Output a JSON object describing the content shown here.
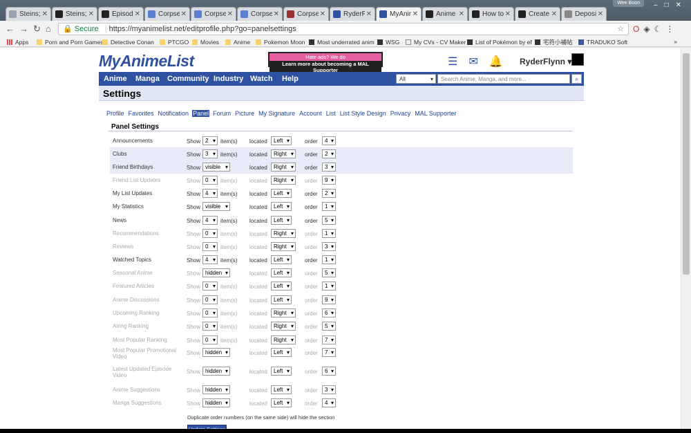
{
  "browser": {
    "tabs": [
      {
        "label": "Steins;G",
        "color": "#9aa3ab"
      },
      {
        "label": "Steins;G",
        "color": "#222"
      },
      {
        "label": "Episodes",
        "color": "#222"
      },
      {
        "label": "Corpse",
        "color": "#5b7fd0"
      },
      {
        "label": "Corpse",
        "color": "#5b7fd0"
      },
      {
        "label": "Corpse",
        "color": "#5b7fd0"
      },
      {
        "label": "Corpse",
        "color": "#a03030"
      },
      {
        "label": "RyderFl",
        "color": "#2e51a2"
      },
      {
        "label": "MyAnim",
        "color": "#2e51a2"
      },
      {
        "label": "Anime",
        "color": "#222"
      },
      {
        "label": "How to",
        "color": "#222"
      },
      {
        "label": "Create",
        "color": "#222"
      },
      {
        "label": "Deposi",
        "color": "#888"
      }
    ],
    "user_chip": "Wee Boon",
    "secure_label": "Secure",
    "url": "https://myanimelist.net/editprofile.php?go=panelsettings",
    "bookmarks": [
      {
        "label": "Apps",
        "kind": "apps"
      },
      {
        "label": "Porn and Porn Games",
        "kind": "folder"
      },
      {
        "label": "Detective Conan",
        "kind": "folder"
      },
      {
        "label": "PTCGO",
        "kind": "folder"
      },
      {
        "label": "Movies",
        "kind": "folder"
      },
      {
        "label": "Anime",
        "kind": "folder"
      },
      {
        "label": "Pokemon Moon",
        "kind": "folder"
      },
      {
        "label": "Most underrated anim",
        "kind": "site"
      },
      {
        "label": "WSG",
        "kind": "site"
      },
      {
        "label": "My CVs - CV Maker",
        "kind": "page"
      },
      {
        "label": "List of Pokémon by ef",
        "kind": "site"
      },
      {
        "label": "宅符小補帖",
        "kind": "site"
      },
      {
        "label": "TRADUKO Soft",
        "kind": "fb"
      }
    ]
  },
  "site": {
    "logo": "MyAnimeList",
    "ad_line1": "Hate ads?  We do",
    "ad_line2": "Learn more about becoming a MAL Supporter",
    "username": "RyderFlynn ▾",
    "nav": [
      "Anime",
      "Manga",
      "Community",
      "Industry",
      "Watch",
      "Help"
    ],
    "search_scope": "All",
    "search_placeholder": "Search Anime, Manga, and more...",
    "page_title": "Settings",
    "subtabs": [
      "Profile",
      "Favorites",
      "Notification",
      "Panel",
      "Forum",
      "Picture",
      "My Signature",
      "Account",
      "List",
      "List Style Design",
      "Privacy",
      "MAL Supporter"
    ],
    "active_subtab": "Panel",
    "section_title": "Panel Settings",
    "labels": {
      "show": "Show",
      "items": "item(s)",
      "located": "located",
      "order": "order"
    },
    "rows": [
      {
        "name": "Announcements",
        "show": "2",
        "located": "Left",
        "order": "4",
        "enabled": true,
        "hl": false
      },
      {
        "name": "Clubs",
        "show": "3",
        "located": "Right",
        "order": "2",
        "enabled": true,
        "hl": true
      },
      {
        "name": "Friend Birthdays",
        "show": "visible",
        "located": "Right",
        "order": "3",
        "enabled": true,
        "hl": true
      },
      {
        "name": "Friend List Updates",
        "show": "0",
        "located": "Right",
        "order": "9",
        "enabled": false,
        "hl": false
      },
      {
        "name": "My List Updates",
        "show": "4",
        "located": "Left",
        "order": "2",
        "enabled": true,
        "hl": false
      },
      {
        "name": "My Statistics",
        "show": "visible",
        "located": "Left",
        "order": "1",
        "enabled": true,
        "hl": false
      },
      {
        "name": "News",
        "show": "4",
        "located": "Left",
        "order": "5",
        "enabled": true,
        "hl": false
      },
      {
        "name": "Recommendations",
        "show": "0",
        "located": "Right",
        "order": "1",
        "enabled": false,
        "hl": false
      },
      {
        "name": "Reviews",
        "show": "0",
        "located": "Right",
        "order": "3",
        "enabled": false,
        "hl": false
      },
      {
        "name": "Watched Topics",
        "show": "4",
        "located": "Left",
        "order": "1",
        "enabled": true,
        "hl": false
      },
      {
        "name": "Seasonal Anime",
        "show": "hidden",
        "located": "Left",
        "order": "5",
        "enabled": false,
        "hl": false
      },
      {
        "name": "Featured Articles",
        "show": "0",
        "located": "Left",
        "order": "1",
        "enabled": false,
        "hl": false
      },
      {
        "name": "Anime Discussions",
        "show": "0",
        "located": "Left",
        "order": "9",
        "enabled": false,
        "hl": false
      },
      {
        "name": "Upcoming Ranking",
        "show": "0",
        "located": "Right",
        "order": "6",
        "enabled": false,
        "hl": false
      },
      {
        "name": "Airing Ranking",
        "show": "0",
        "located": "Right",
        "order": "5",
        "enabled": false,
        "hl": false
      },
      {
        "name": "Most Popular Ranking",
        "show": "0",
        "located": "Right",
        "order": "7",
        "enabled": false,
        "hl": false
      },
      {
        "name": "Most Popular Promotional Video",
        "show": "hidden",
        "located": "Left",
        "order": "7",
        "enabled": false,
        "hl": false
      },
      {
        "name": "Latest Updated Episode Video",
        "show": "hidden",
        "located": "Left",
        "order": "6",
        "enabled": false,
        "hl": false
      },
      {
        "name": "Anime Suggestions",
        "show": "hidden",
        "located": "Left",
        "order": "3",
        "enabled": false,
        "hl": false
      },
      {
        "name": "Manga Suggestions",
        "show": "hidden",
        "located": "Left",
        "order": "4",
        "enabled": false,
        "hl": false
      }
    ],
    "footnote": "Duplicate order numbers (on the same side) will hide the section",
    "update_button": "Update Settings"
  },
  "colors": {
    "brand": "#2e51a2",
    "highlight": "#e8ebf8"
  }
}
